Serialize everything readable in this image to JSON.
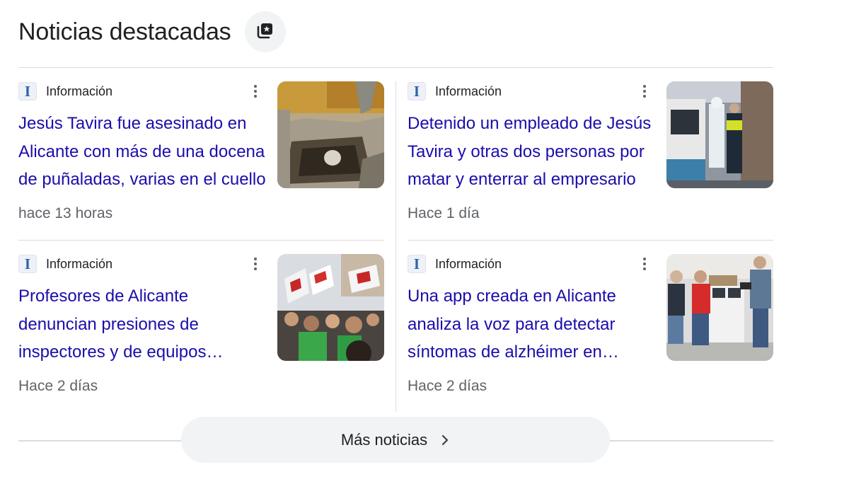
{
  "header": {
    "title": "Noticias destacadas",
    "icon": "newspaper-icon"
  },
  "articles": [
    {
      "source": "Información",
      "headline": "Jesús Tavira fue asesinado en Alicante con más de una docena de puñaladas, varias en el cuello",
      "time": "hace 13 horas",
      "thumbnail": "excavated-pit-image"
    },
    {
      "source": "Información",
      "headline": "Detenido un empleado de Jesús Tavira y otras dos personas por matar y enterrar al empresario",
      "time": "Hace 1 día",
      "thumbnail": "police-forensic-van-image"
    },
    {
      "source": "Información",
      "headline": "Profesores de Alicante denuncian presiones de inspectores y de equipos directivos",
      "time": "Hace 2 días",
      "thumbnail": "teachers-protest-image"
    },
    {
      "source": "Información",
      "headline": "Una app creada en Alicante analiza la voz para detectar síntomas de alzhéimer en pacientes",
      "time": "Hace 2 días",
      "thumbnail": "app-developers-office-image"
    }
  ],
  "footer": {
    "more_label": "Más noticias",
    "icon": "chevron-right-icon"
  },
  "colors": {
    "headline": "#1a0dab",
    "meta": "#5f6368",
    "divider": "#dadce0",
    "button_bg": "#f1f3f4"
  }
}
